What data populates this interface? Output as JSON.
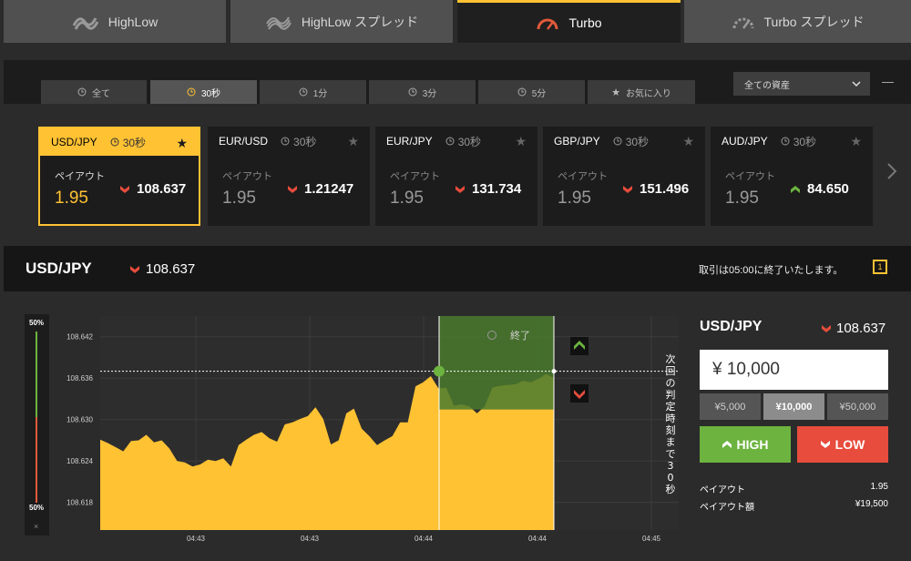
{
  "top_tabs": [
    {
      "label": "HighLow",
      "icon": "highlow-icon"
    },
    {
      "label": "HighLow スプレッド",
      "icon": "highlow-spread-icon"
    },
    {
      "label": "Turbo",
      "icon": "turbo-gauge-icon",
      "active": true
    },
    {
      "label": "Turbo スプレッド",
      "icon": "turbo-spread-gauge-icon"
    }
  ],
  "sub_tabs": [
    {
      "label": "全て",
      "icon": "clock-icon"
    },
    {
      "label": "30秒",
      "icon": "clock-icon",
      "active": true
    },
    {
      "label": "1分",
      "icon": "clock-icon"
    },
    {
      "label": "3分",
      "icon": "clock-icon"
    },
    {
      "label": "5分",
      "icon": "clock-icon"
    },
    {
      "label": "お気に入り",
      "icon": "star-icon"
    }
  ],
  "asset_select": {
    "value": "全ての資産"
  },
  "minimize_label": "—",
  "cards": [
    {
      "pair": "USD/JPY",
      "duration": "30秒",
      "payout_label": "ペイアウト",
      "payout": "1.95",
      "rate": "108.637",
      "dir": "down",
      "selected": true
    },
    {
      "pair": "EUR/USD",
      "duration": "30秒",
      "payout_label": "ペイアウト",
      "payout": "1.95",
      "rate": "1.21247",
      "dir": "down"
    },
    {
      "pair": "EUR/JPY",
      "duration": "30秒",
      "payout_label": "ペイアウト",
      "payout": "1.95",
      "rate": "131.734",
      "dir": "down"
    },
    {
      "pair": "GBP/JPY",
      "duration": "30秒",
      "payout_label": "ペイアウト",
      "payout": "1.95",
      "rate": "151.496",
      "dir": "down"
    },
    {
      "pair": "AUD/JPY",
      "duration": "30秒",
      "payout_label": "ペイアウト",
      "payout": "1.95",
      "rate": "84.650",
      "dir": "up"
    }
  ],
  "info_bar": {
    "pair": "USD/JPY",
    "rate": "108.637",
    "notice": "取引は05:00に終了いたします。",
    "help_icon_label": "1"
  },
  "side_gauge": {
    "top_label": "50%",
    "bottom_label": "50%",
    "close_label": "×",
    "up_share": 0.5
  },
  "colors": {
    "accent": "#ffc233",
    "high": "#6db33f",
    "low": "#e74c3c",
    "area": "#ffc233",
    "window": "#4a7a2e"
  },
  "chart_data": {
    "type": "area",
    "y_ticks": [
      "108.642",
      "108.636",
      "108.630",
      "108.624",
      "108.618"
    ],
    "ylim": [
      108.614,
      108.645
    ],
    "x_ticks": [
      "04:43",
      "04:43",
      "04:44",
      "04:44",
      "04:45"
    ],
    "current_price": 108.637,
    "expiry_window_label": "終了",
    "next_expiry_text": "次回の判定時刻まで30秒",
    "values": [
      108.6271,
      108.6266,
      108.626,
      108.6254,
      108.6269,
      108.627,
      108.6278,
      108.6267,
      108.627,
      108.6258,
      108.624,
      108.6238,
      108.6232,
      108.6235,
      108.6242,
      108.624,
      108.6244,
      108.6232,
      108.6263,
      108.6271,
      108.6278,
      108.6282,
      108.6273,
      108.6268,
      108.6293,
      108.6296,
      108.6301,
      108.6305,
      108.6318,
      108.6301,
      108.6264,
      108.627,
      108.6309,
      108.6316,
      108.6287,
      108.6276,
      108.6263,
      108.627,
      108.6276,
      108.6296,
      108.6296,
      108.6348,
      108.6354,
      108.6363,
      108.6345,
      108.6346,
      108.632,
      108.6322,
      108.6319,
      108.6309,
      108.6319,
      108.6346,
      108.6349,
      108.635,
      108.6351,
      108.6356,
      108.6354,
      108.6359,
      108.6366,
      108.636
    ]
  },
  "trade_panel": {
    "pair": "USD/JPY",
    "rate": "108.637",
    "amount": "¥ 10,000",
    "quick_amounts": [
      "¥5,000",
      "¥10,000",
      "¥50,000"
    ],
    "high_label": "HIGH",
    "low_label": "LOW",
    "payout_label": "ペイアウト",
    "payout_value": "1.95",
    "payout_amount_label": "ペイアウト額",
    "payout_amount_value": "¥19,500"
  }
}
